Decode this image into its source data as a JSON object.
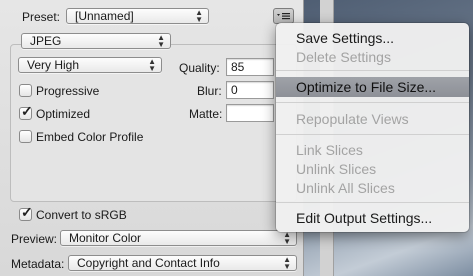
{
  "preset": {
    "label": "Preset:",
    "value": "[Unnamed]"
  },
  "format": {
    "value": "JPEG"
  },
  "quality_preset": {
    "value": "Very High"
  },
  "quality": {
    "label": "Quality:",
    "value": "85"
  },
  "blur": {
    "label": "Blur:",
    "value": "0"
  },
  "matte": {
    "label": "Matte:",
    "value": ""
  },
  "options": {
    "progressive": {
      "label": "Progressive",
      "checked": false
    },
    "optimized": {
      "label": "Optimized",
      "checked": true
    },
    "embed_profile": {
      "label": "Embed Color Profile",
      "checked": false
    },
    "convert_srgb": {
      "label": "Convert to sRGB",
      "checked": true
    }
  },
  "preview": {
    "label": "Preview:",
    "value": "Monitor Color"
  },
  "metadata": {
    "label": "Metadata:",
    "value": "Copyright and Contact Info"
  },
  "menu": {
    "items": [
      {
        "label": "Save Settings...",
        "enabled": true
      },
      {
        "label": "Delete Settings",
        "enabled": false
      },
      {
        "label": "Optimize to File Size...",
        "enabled": true,
        "highlighted": true
      },
      {
        "label": "Repopulate Views",
        "enabled": false
      },
      {
        "label": "Link Slices",
        "enabled": false
      },
      {
        "label": "Unlink Slices",
        "enabled": false
      },
      {
        "label": "Unlink All Slices",
        "enabled": false
      },
      {
        "label": "Edit Output Settings...",
        "enabled": true
      }
    ]
  },
  "glyphs": {
    "check": "✓",
    "popup_arrows": "▲▼",
    "menu_icon": "≡"
  }
}
